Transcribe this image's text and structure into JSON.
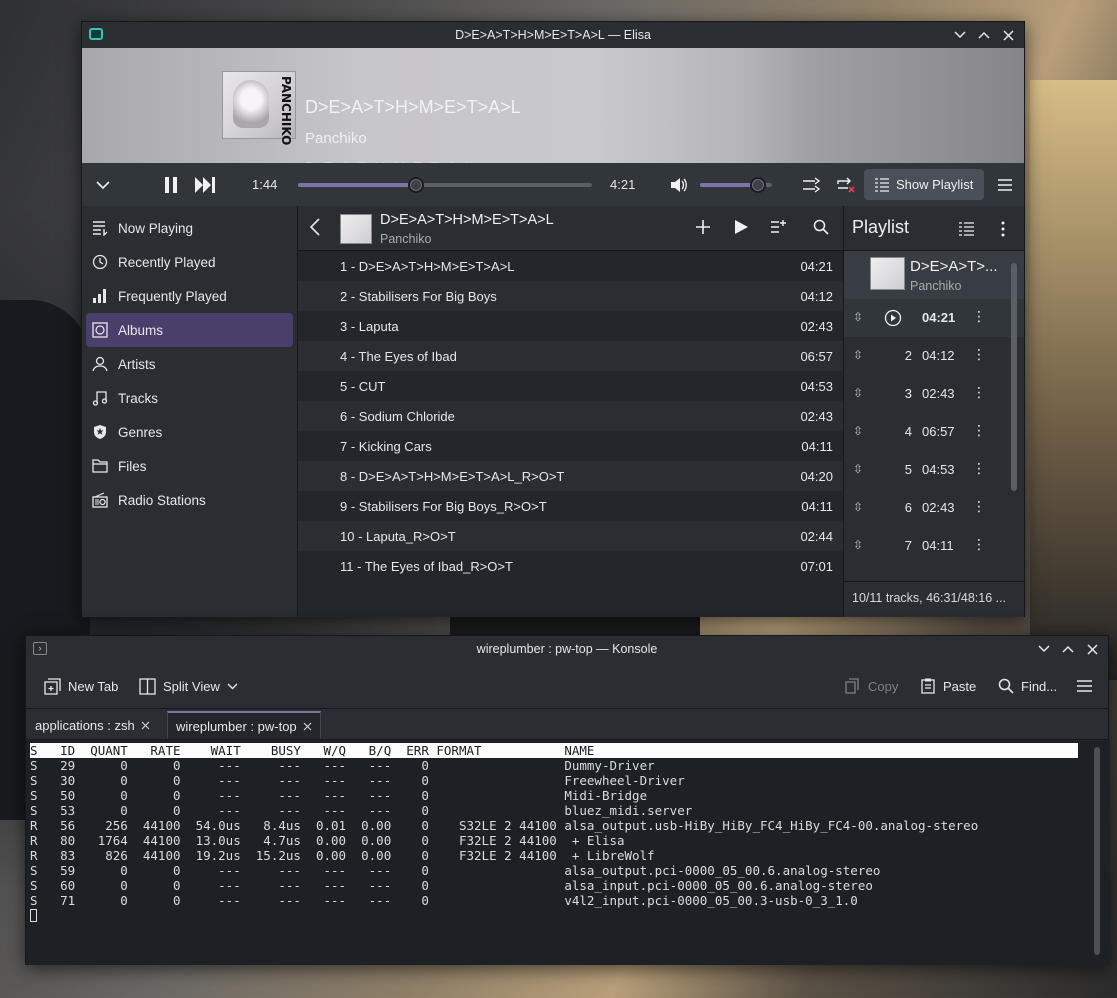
{
  "elisa": {
    "window_title": "D>E>A>T>H>M>E>T>A>L — Elisa",
    "now_playing": {
      "title": "D>E>A>T>H>M>E>T>A>L",
      "artist": "Panchiko",
      "album": "D>E>A>T>H>M>E>T>A>L",
      "cover_text": "PANCHIKO"
    },
    "controls": {
      "elapsed": "1:44",
      "total": "4:21",
      "progress": 0.4,
      "volume": 0.8,
      "show_playlist_label": "Show Playlist"
    },
    "sidebar": {
      "items": [
        {
          "label": "Now Playing",
          "icon": "now-playing-icon"
        },
        {
          "label": "Recently Played",
          "icon": "clock-icon"
        },
        {
          "label": "Frequently Played",
          "icon": "bar-chart-icon"
        },
        {
          "label": "Albums",
          "icon": "album-icon"
        },
        {
          "label": "Artists",
          "icon": "person-icon"
        },
        {
          "label": "Tracks",
          "icon": "music-note-icon"
        },
        {
          "label": "Genres",
          "icon": "star-badge-icon"
        },
        {
          "label": "Files",
          "icon": "folder-icon"
        },
        {
          "label": "Radio Stations",
          "icon": "radio-icon"
        }
      ],
      "active": "Albums"
    },
    "album_view": {
      "title": "D>E>A>T>H>M>E>T>A>L",
      "artist": "Panchiko",
      "tracks": [
        {
          "name": "1 - D>E>A>T>H>M>E>T>A>L",
          "duration": "04:21"
        },
        {
          "name": "2 - Stabilisers For Big Boys",
          "duration": "04:12"
        },
        {
          "name": "3 - Laputa",
          "duration": "02:43"
        },
        {
          "name": "4 - The Eyes of Ibad",
          "duration": "06:57"
        },
        {
          "name": "5 - CUT",
          "duration": "04:53"
        },
        {
          "name": "6 - Sodium Chloride",
          "duration": "02:43"
        },
        {
          "name": "7 - Kicking Cars",
          "duration": "04:11"
        },
        {
          "name": "8 - D>E>A>T>H>M>E>T>A>L_R>O>T",
          "duration": "04:20"
        },
        {
          "name": "9 - Stabilisers For Big Boys_R>O>T",
          "duration": "04:11"
        },
        {
          "name": "10 - Laputa_R>O>T",
          "duration": "02:44"
        },
        {
          "name": "11 - The Eyes of Ibad_R>O>T",
          "duration": "07:01"
        }
      ]
    },
    "playlist": {
      "title": "Playlist",
      "current_title": "D>E>A>T>...",
      "current_artist": "Panchiko",
      "rows": [
        {
          "num": "",
          "duration": "04:21",
          "playing": true
        },
        {
          "num": "2",
          "duration": "04:12"
        },
        {
          "num": "3",
          "duration": "02:43"
        },
        {
          "num": "4",
          "duration": "06:57"
        },
        {
          "num": "5",
          "duration": "04:53"
        },
        {
          "num": "6",
          "duration": "02:43"
        },
        {
          "num": "7",
          "duration": "04:11"
        }
      ],
      "footer": "10/11 tracks, 46:31/48:16 ..."
    }
  },
  "konsole": {
    "window_title": "wireplumber : pw-top — Konsole",
    "toolbar": {
      "new_tab": "New Tab",
      "split_view": "Split View",
      "copy": "Copy",
      "paste": "Paste",
      "find": "Find..."
    },
    "tabs": [
      {
        "label": "applications : zsh",
        "active": false
      },
      {
        "label": "wireplumber : pw-top",
        "active": true
      }
    ],
    "terminal": {
      "header": "S   ID  QUANT   RATE    WAIT    BUSY   W/Q   B/Q  ERR FORMAT           NAME",
      "lines": [
        "S   29      0      0     ---     ---   ---   ---    0                  Dummy-Driver",
        "S   30      0      0     ---     ---   ---   ---    0                  Freewheel-Driver",
        "S   50      0      0     ---     ---   ---   ---    0                  Midi-Bridge",
        "S   53      0      0     ---     ---   ---   ---    0                  bluez_midi.server",
        "R   56    256  44100  54.0us   8.4us  0.01  0.00    0    S32LE 2 44100 alsa_output.usb-HiBy_HiBy_FC4_HiBy_FC4-00.analog-stereo",
        "R   80   1764  44100  13.0us   4.7us  0.00  0.00    0    F32LE 2 44100  + Elisa",
        "R   83    826  44100  19.2us  15.2us  0.00  0.00    0    F32LE 2 44100  + LibreWolf",
        "S   59      0      0     ---     ---   ---   ---    0                  alsa_output.pci-0000_05_00.6.analog-stereo",
        "S   60      0      0     ---     ---   ---   ---    0                  alsa_input.pci-0000_05_00.6.analog-stereo",
        "S   71      0      0     ---     ---   ---   ---    0                  v4l2_input.pci-0000_05_00.3-usb-0_3_1.0"
      ]
    }
  },
  "colors": {
    "accent": "#7e74a8",
    "active_sidebar": "#4a3f6b",
    "background": "#23262b"
  }
}
